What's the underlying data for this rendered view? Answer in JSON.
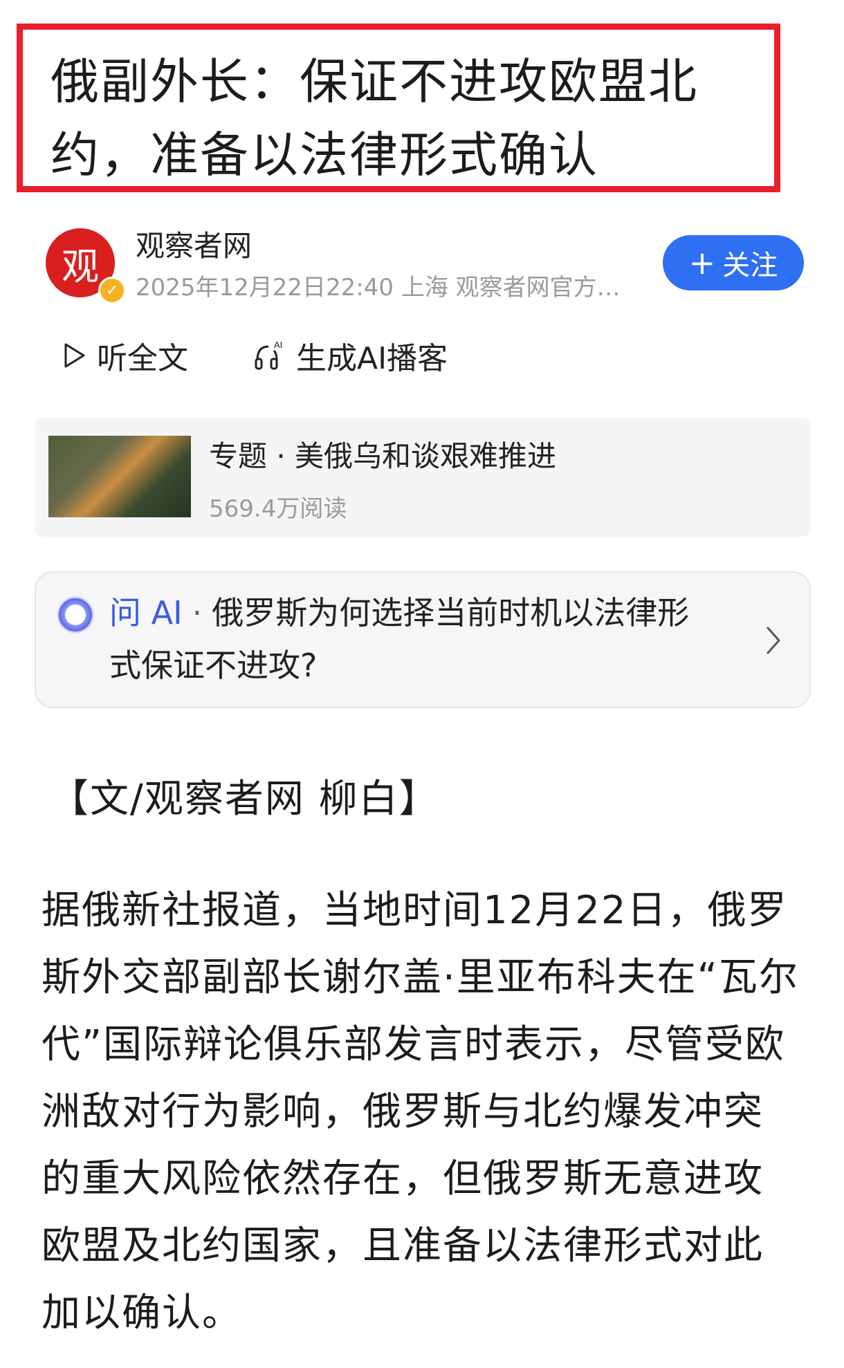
{
  "headline": "俄副外长：保证不进攻欧盟北约，准备以法律形式确认",
  "source": {
    "avatar_text": "观",
    "name": "观察者网",
    "meta": "2025年12月22日22:40 上海 观察者网官方…",
    "follow_icon": "plus-icon",
    "follow_label": "关注",
    "verified_icon": "check-icon"
  },
  "actions": {
    "listen_label": "听全文",
    "listen_icon": "play-icon",
    "podcast_label": "生成AI播客",
    "podcast_icon": "headphones-ai-icon",
    "podcast_icon_badge": "AI"
  },
  "topic": {
    "title": "专题 · 美俄乌和谈艰难推进",
    "reads": "569.4万阅读"
  },
  "ask_ai": {
    "label": "问 AI",
    "separator": "·",
    "question": "俄罗斯为何选择当前时机以法律形式保证不进攻?"
  },
  "byline": "【文/观察者网 柳白】",
  "body": "据俄新社报道，当地时间12月22日，俄罗斯外交部副部长谢尔盖·里亚布科夫在“瓦尔代”国际辩论俱乐部发言时表示，尽管受欧洲敌对行为影响，俄罗斯与北约爆发冲突的重大风险依然存在，但俄罗斯无意进攻欧盟及北约国家，且准备以法律形式对此加以确认。",
  "colors": {
    "headline_border": "#e8202c",
    "follow_button": "#2f6ff2",
    "ask_label": "#3a5be4",
    "avatar_bg": "#d9201f"
  }
}
